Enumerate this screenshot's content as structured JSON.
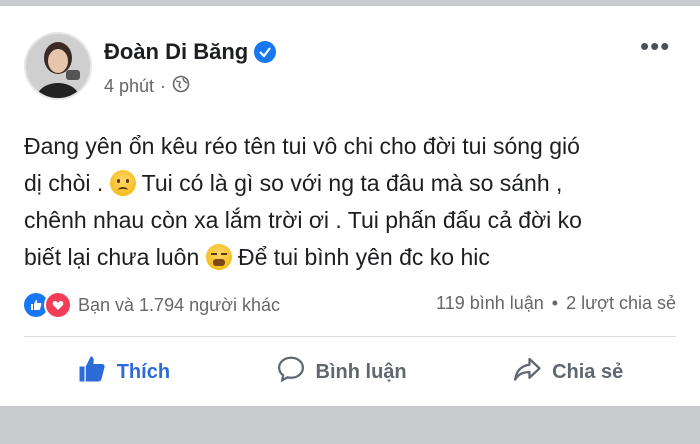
{
  "post": {
    "author": "Đoàn Di Băng",
    "time": "4 phút",
    "separator": "·",
    "text_lines": [
      "Đang yên ổn kêu réo tên tui vô chi cho đời tui sóng gió",
      "dị chòi .",
      "Tui có là gì so với ng ta đâu mà so sánh ,",
      "chênh nhau còn xa lắm trời ơi . Tui phấn đấu cả đời ko",
      "biết lại chưa luôn",
      "Để tui bình yên đc ko hic"
    ]
  },
  "reactions": {
    "text": "Bạn và 1.794 người khác",
    "comments": "119 bình luận",
    "dot": "•",
    "shares": "2 lượt chia sẻ"
  },
  "actions": {
    "like": "Thích",
    "comment": "Bình luận",
    "share": "Chia sẻ"
  },
  "colors": {
    "accent": "#1877f2",
    "love": "#f33e58"
  }
}
